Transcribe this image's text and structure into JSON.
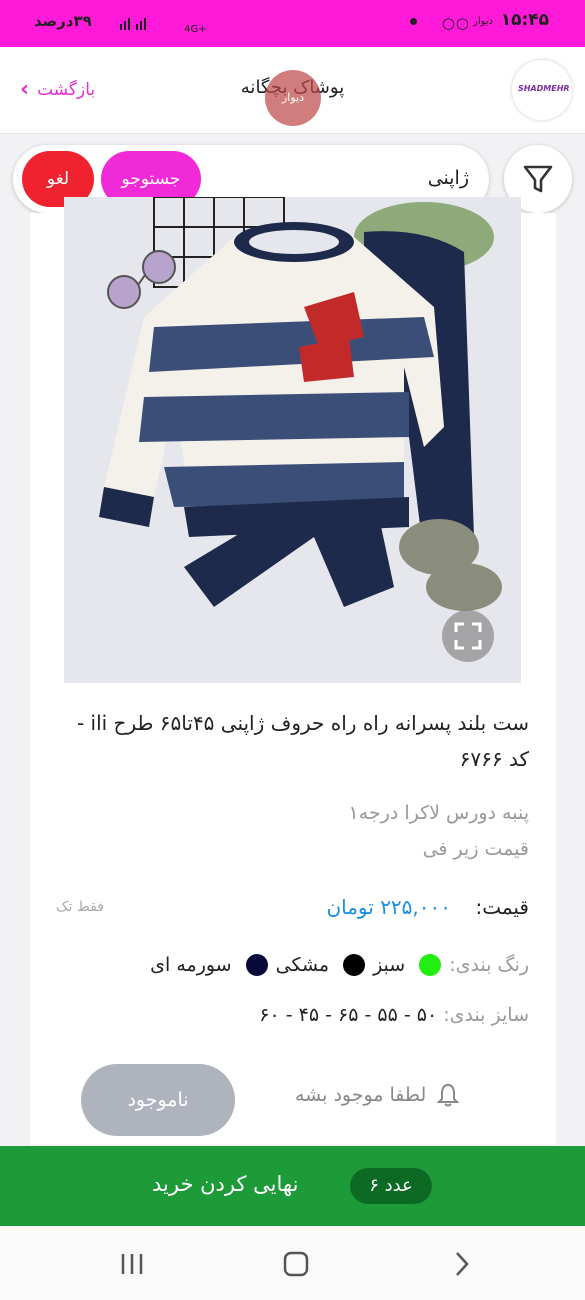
{
  "status_bar": {
    "time": "۱۵:۴۵",
    "brand_small": "دیوار",
    "battery": "۳۹درصد",
    "network": "4G+"
  },
  "header": {
    "back_label": "بازگشت",
    "title": "پوشاک بچگانه",
    "watermark": "دیوار",
    "logo_text": "SHADMEHR"
  },
  "search": {
    "value": "ژاپنی",
    "search_label": "جستوجو",
    "cancel_label": "لغو"
  },
  "product": {
    "title": "ست بلند پسرانه راه راه حروف ژاپنی ۴۵تا۶۵ طرح ili - کد ۶۷۶۶",
    "description_line1": "پنبه دورس لاکرا درجه۱",
    "description_line2": "قیمت زیر فی",
    "price_label": "قیمت:",
    "price_value": "۲۲۵,۰۰۰ تومان",
    "single_only": "فقط تک",
    "colors_label": "رنگ بندی:",
    "colors": [
      {
        "name": "سبز",
        "hex": "#22ee11"
      },
      {
        "name": "مشکی",
        "hex": "#000000"
      },
      {
        "name": "سورمه ای",
        "hex": "#0a0a3a"
      }
    ],
    "sizes_label": "سایز بندی:",
    "sizes": "۵۰ - ۵۵ - ۶۵ - ۴۵ - ۶۰",
    "out_of_stock_label": "ناموجود",
    "notify_label": "لطفا موجود بشه"
  },
  "checkout": {
    "count": "۶ عدد",
    "label": "نهایی کردن خرید"
  },
  "colors": {
    "status_bar": "#ff1ad9",
    "accent": "#f02ad7",
    "cancel": "#f0222f",
    "checkout": "#1d9b38",
    "price": "#1a8fe0"
  }
}
